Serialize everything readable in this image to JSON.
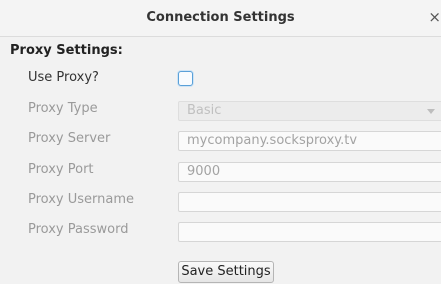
{
  "window": {
    "title": "Connection Settings",
    "close_glyph": "×"
  },
  "section": {
    "heading": "Proxy Settings:"
  },
  "fields": {
    "use_proxy": {
      "label": "Use Proxy?",
      "checked": false
    },
    "proxy_type": {
      "label": "Proxy Type",
      "value": "Basic",
      "enabled": false
    },
    "proxy_server": {
      "label": "Proxy Server",
      "value": "mycompany.socksproxy.tv",
      "enabled": false
    },
    "proxy_port": {
      "label": "Proxy Port",
      "value": "9000",
      "enabled": false
    },
    "proxy_username": {
      "label": "Proxy Username",
      "value": "",
      "enabled": false
    },
    "proxy_password": {
      "label": "Proxy Password",
      "value": "",
      "enabled": false
    }
  },
  "actions": {
    "save_label": "Save Settings"
  },
  "colors": {
    "checkbox_focus": "#5aa0d8",
    "disabled_text": "#9a9a9a"
  }
}
